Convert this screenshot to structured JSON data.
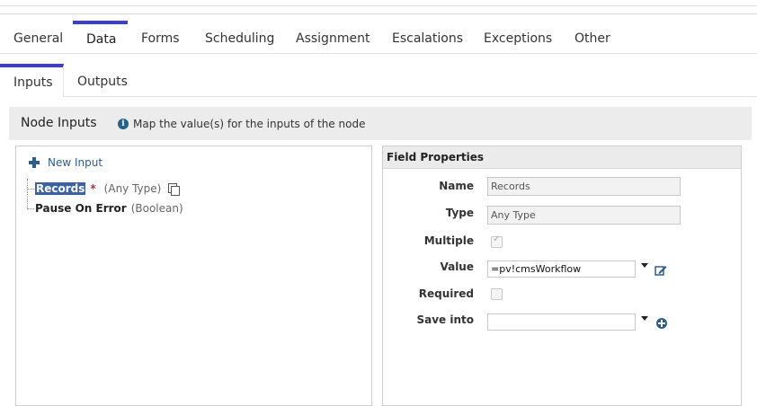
{
  "tabs": [
    "General",
    "Data",
    "Forms",
    "Scheduling",
    "Assignment",
    "Escalations",
    "Exceptions",
    "Other"
  ],
  "active_tab": "Data",
  "subtabs": [
    "Inputs",
    "Outputs"
  ],
  "active_subtab": "Inputs",
  "node_inputs": {
    "title": "Node Inputs",
    "info_icon": "info-icon",
    "info_text": "Map the value(s) for the inputs of the node"
  },
  "tree": {
    "new_input_label": "New Input",
    "new_input_icon": "plus-icon",
    "items": [
      {
        "name": "Records",
        "required": "*",
        "type": "(Any Type)",
        "selected": true
      },
      {
        "name": "Pause On Error",
        "type": "(Boolean)",
        "selected": false
      }
    ]
  },
  "field_properties": {
    "header": "Field Properties",
    "name_label": "Name",
    "name_value": "Records",
    "type_label": "Type",
    "type_value": "Any Type",
    "multiple_label": "Multiple",
    "multiple_checked": true,
    "value_label": "Value",
    "value_value": "=pv!cmsWorkflow",
    "required_label": "Required",
    "required_checked": false,
    "save_into_label": "Save into",
    "save_into_value": ""
  },
  "colors": {
    "accent": "#3b3ecf",
    "link": "#2c5e8d",
    "selection": "#3d62a4",
    "required": "#c62828"
  }
}
